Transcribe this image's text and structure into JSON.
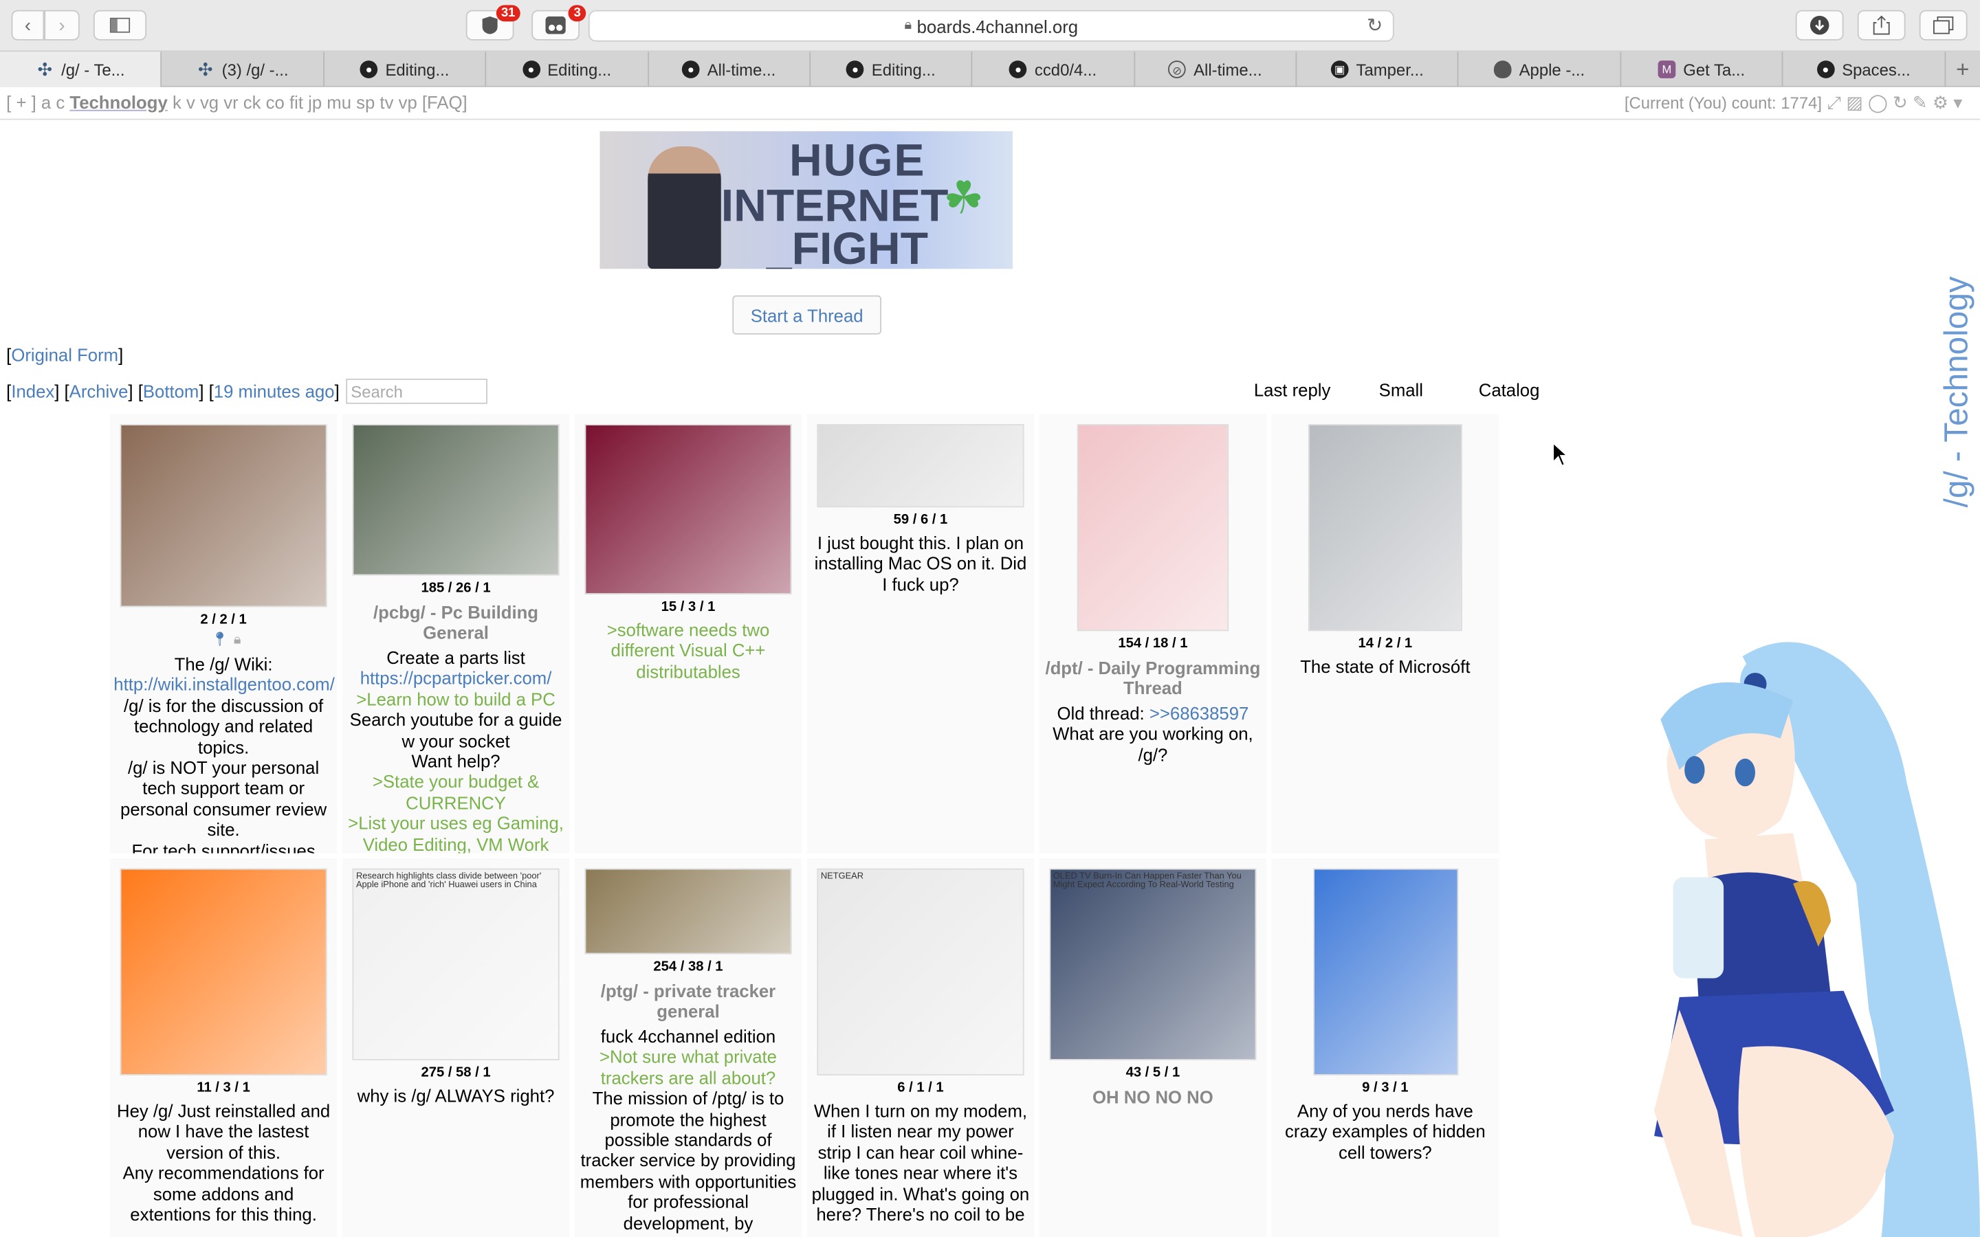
{
  "browser": {
    "badge_ublock": "31",
    "badge_ext": "3",
    "url": "boards.4channel.org",
    "tabs": [
      {
        "label": "/g/ - Te...",
        "icon": "clover-icon"
      },
      {
        "label": "(3) /g/ -...",
        "icon": "clover-icon"
      },
      {
        "label": "Editing...",
        "icon": "github-icon"
      },
      {
        "label": "Editing...",
        "icon": "github-icon"
      },
      {
        "label": "All-time...",
        "icon": "github-icon"
      },
      {
        "label": "Editing...",
        "icon": "github-icon"
      },
      {
        "label": "ccd0/4...",
        "icon": "github-icon"
      },
      {
        "label": "All-time...",
        "icon": "compass-icon"
      },
      {
        "label": "Tamper...",
        "icon": "tampermonkey-icon"
      },
      {
        "label": "Apple -...",
        "icon": "apple-icon"
      },
      {
        "label": "Get Ta...",
        "icon": "m-icon"
      },
      {
        "label": "Spaces...",
        "icon": "github-icon"
      }
    ]
  },
  "boardnav": {
    "prefix": "[ + ] a c",
    "current": "Technology",
    "boards": "k v vg vr ck co fit jp mu sp tv vp [FAQ]",
    "you_count": "[Current (You) count: 1774]"
  },
  "page": {
    "start_thread": "Start a Thread",
    "original_form": "Original Form",
    "index": "Index",
    "archive": "Archive",
    "bottom": "Bottom",
    "updated": "19 minutes ago",
    "search_placeholder": "Search",
    "sort_last_reply": "Last reply",
    "sort_small": "Small",
    "sort_catalog": "Catalog",
    "vertical_title": "/g/ - Technology",
    "banner_line1": "HUGE",
    "banner_line2": "INTERNET",
    "banner_line3": "_FIGHT"
  },
  "threads": [
    {
      "stats": "2 / 2 / 1",
      "title": "",
      "lines": [
        {
          "t": "The /g/ Wiki:"
        },
        {
          "t": "http://wiki.installgentoo.com/",
          "link": true
        },
        {
          "t": "/g/ is for the discussion of technology and related topics."
        },
        {
          "t": "/g/ is NOT your personal tech support team or personal consumer review site."
        },
        {
          "t": "For tech support/issues with"
        }
      ],
      "thumb_color": "#8a6a55"
    },
    {
      "stats": "185 / 26 / 1",
      "title": "/pcbg/ - Pc Building General",
      "lines": [
        {
          "t": "Create a parts list"
        },
        {
          "t": "https://pcpartpicker.com/",
          "link": true
        },
        {
          "t": ">Learn how to build a PC",
          "gt": true
        },
        {
          "t": "Search youtube for a guide w your socket"
        },
        {
          "t": "Want help?"
        },
        {
          "t": ">State your budget & CURRENCY",
          "gt": true
        },
        {
          "t": ">List your uses eg Gaming, Video Editing, VM Work",
          "gt": true
        }
      ],
      "thumb_color": "#5b6a58"
    },
    {
      "stats": "15 / 3 / 1",
      "title": "",
      "lines": [
        {
          "t": ">software needs two different Visual C++ distributables",
          "gt": true
        }
      ],
      "thumb_color": "#7a1030"
    },
    {
      "stats": "59 / 6 / 1",
      "title": "",
      "lines": [
        {
          "t": "I just bought this. I plan on installing Mac OS on it. Did I fuck up?"
        }
      ],
      "thumb_color": "#dcdcdc"
    },
    {
      "stats": "154 / 18 / 1",
      "title": "/dpt/ - Daily Programming Thread",
      "lines": [
        {
          "t": "Old thread: ",
          "quote": ">>68638597"
        },
        {
          "t": "What are you working on, /g/?"
        }
      ],
      "thumb_color": "#f1c4c8"
    },
    {
      "stats": "14 / 2 / 1",
      "title": "",
      "lines": [
        {
          "t": "The state of Microsóft"
        }
      ],
      "thumb_color": "#b8bcc0"
    },
    {
      "stats": "11 / 3 / 1",
      "title": "",
      "lines": [
        {
          "t": "Hey /g/ Just reinstalled and now I have the lastest version of this."
        },
        {
          "t": "Any recommendations for some addons and extentions for this thing."
        }
      ],
      "thumb_color": "#ff7a1a"
    },
    {
      "stats": "275 / 58 / 1",
      "title": "",
      "lines": [
        {
          "t": "why is /g/ ALWAYS right?"
        }
      ],
      "thumb_color": "#f0f0f0",
      "thumb_caption": "Research highlights class divide between 'poor' Apple iPhone and 'rich' Huawei users in China"
    },
    {
      "stats": "254 / 38 / 1",
      "title": "/ptg/ - private tracker general",
      "lines": [
        {
          "t": "fuck 4cchannel edition"
        },
        {
          "t": ">Not sure what private trackers are all about?",
          "gt": true
        },
        {
          "t": "The mission of /ptg/ is to promote the highest possible standards of tracker service by providing members with opportunities for professional development, by"
        }
      ],
      "thumb_color": "#8c7a55"
    },
    {
      "stats": "6 / 1 / 1",
      "title": "",
      "lines": [
        {
          "t": "When I turn on my modem, if I listen near my power strip I can hear coil whine-like tones near where it's plugged in. What's going on here? There's no coil to be"
        }
      ],
      "thumb_color": "#e8e8e8",
      "thumb_caption": "NETGEAR"
    },
    {
      "stats": "43 / 5 / 1",
      "title": "OH NO NO NO",
      "lines": [],
      "thumb_color": "#3a4a6a",
      "thumb_caption": "OLED TV Burn-In Can Happen Faster Than You Might Expect According To Real-World Testing"
    },
    {
      "stats": "9 / 3 / 1",
      "title": "",
      "lines": [
        {
          "t": "Any of you nerds have crazy examples of hidden cell towers?"
        }
      ],
      "thumb_color": "#3c78d8"
    }
  ]
}
